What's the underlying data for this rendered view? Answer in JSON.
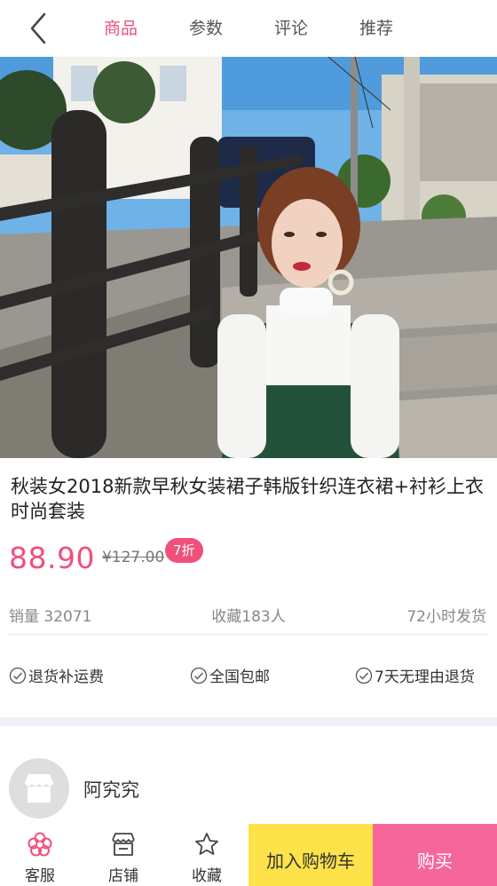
{
  "nav": {
    "back_icon": "chevron-left-icon",
    "tabs": [
      {
        "label": "商品",
        "active": true
      },
      {
        "label": "参数",
        "active": false
      },
      {
        "label": "评论",
        "active": false
      },
      {
        "label": "推荐",
        "active": false
      }
    ]
  },
  "product": {
    "title": "秋装女2018新款早秋女装裙子韩版针织连衣裙+衬衫上衣时尚套装",
    "price": "88.90",
    "original_price": "¥127.00",
    "discount_badge": "7折",
    "sales": "销量 32071",
    "favorites": "收藏183人",
    "shipping": "72小时发货",
    "services": [
      "退货补运费",
      "全国包邮",
      "7天无理由退货"
    ]
  },
  "shop": {
    "name": "阿究究",
    "avatar_icon": "store-icon"
  },
  "bottom_bar": {
    "service_label": "客服",
    "store_label": "店铺",
    "favorite_label": "收藏",
    "add_to_cart_label": "加入购物车",
    "buy_label": "购买"
  },
  "colors": {
    "accent_pink": "#f0507c",
    "cart_yellow": "#fde24a",
    "buy_pink": "#f6669a"
  }
}
